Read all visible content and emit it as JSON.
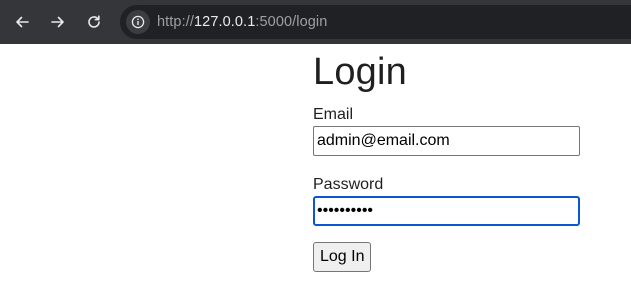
{
  "browser": {
    "url_prefix": "http://",
    "url_host": "127.0.0.1",
    "url_path": ":5000/login",
    "icons": {
      "back": "arrow-left",
      "forward": "arrow-right",
      "reload": "reload",
      "site_info": "info-circle"
    },
    "colors": {
      "toolbar": "#35363a",
      "omnibox": "#202124",
      "focus_ring": "#0b57d0"
    }
  },
  "page": {
    "title": "Login",
    "email_label": "Email",
    "email_value": "admin@email.com",
    "password_label": "Password",
    "password_value": "••••••••••",
    "submit_label": "Log In"
  }
}
